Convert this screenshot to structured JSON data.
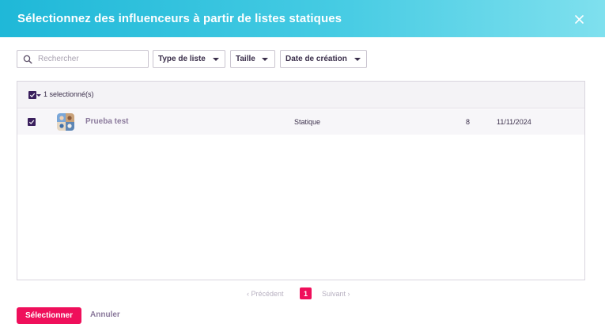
{
  "header": {
    "title": "Sélectionnez des influenceurs à partir de listes statiques",
    "close_icon": "close-icon"
  },
  "search": {
    "placeholder": "Rechercher",
    "value": "",
    "icon": "search-icon"
  },
  "filters": [
    {
      "label": "Type de liste"
    },
    {
      "label": "Taille"
    },
    {
      "label": "Date de création"
    }
  ],
  "table": {
    "header": {
      "selected_count": "1 selectionné(s)",
      "checked": true
    },
    "rows": [
      {
        "checked": true,
        "name": "Prueba test",
        "type": "Statique",
        "size": "8",
        "date": "11/11/2024"
      }
    ]
  },
  "pagination": {
    "prev_label": "Précédent",
    "current_page": "1",
    "next_label": "Suivant"
  },
  "footer": {
    "select_label": "Sélectionner",
    "cancel_label": "Annuler"
  },
  "colors": {
    "accent": "#ef0f5b",
    "header_start": "#1fb8d8",
    "header_end": "#7fe0ee",
    "checkbox": "#3a1f5d"
  }
}
